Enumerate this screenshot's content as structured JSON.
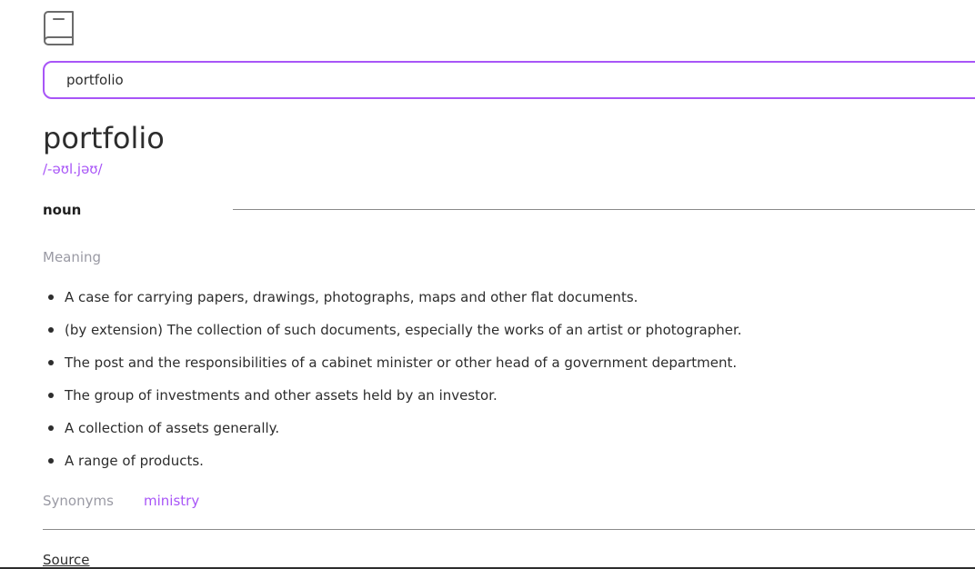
{
  "search": {
    "value": "portfolio"
  },
  "entry": {
    "word": "portfolio",
    "phonetic": "/-əʊl.jəʊ/",
    "part_of_speech": "noun",
    "meaning_label": "Meaning",
    "meanings": [
      "A case for carrying papers, drawings, photographs, maps and other flat documents.",
      "(by extension) The collection of such documents, especially the works of an artist or photographer.",
      "The post and the responsibilities of a cabinet minister or other head of a government department.",
      "The group of investments and other assets held by an investor.",
      "A collection of assets generally.",
      "A range of products."
    ],
    "synonyms_label": "Synonyms",
    "synonyms": [
      "ministry"
    ]
  },
  "footer": {
    "source_label": "Source"
  },
  "colors": {
    "accent": "#a855f7",
    "muted": "#9a9aa4",
    "text": "#2d2d2d"
  },
  "icons": {
    "logo": "book-icon"
  }
}
